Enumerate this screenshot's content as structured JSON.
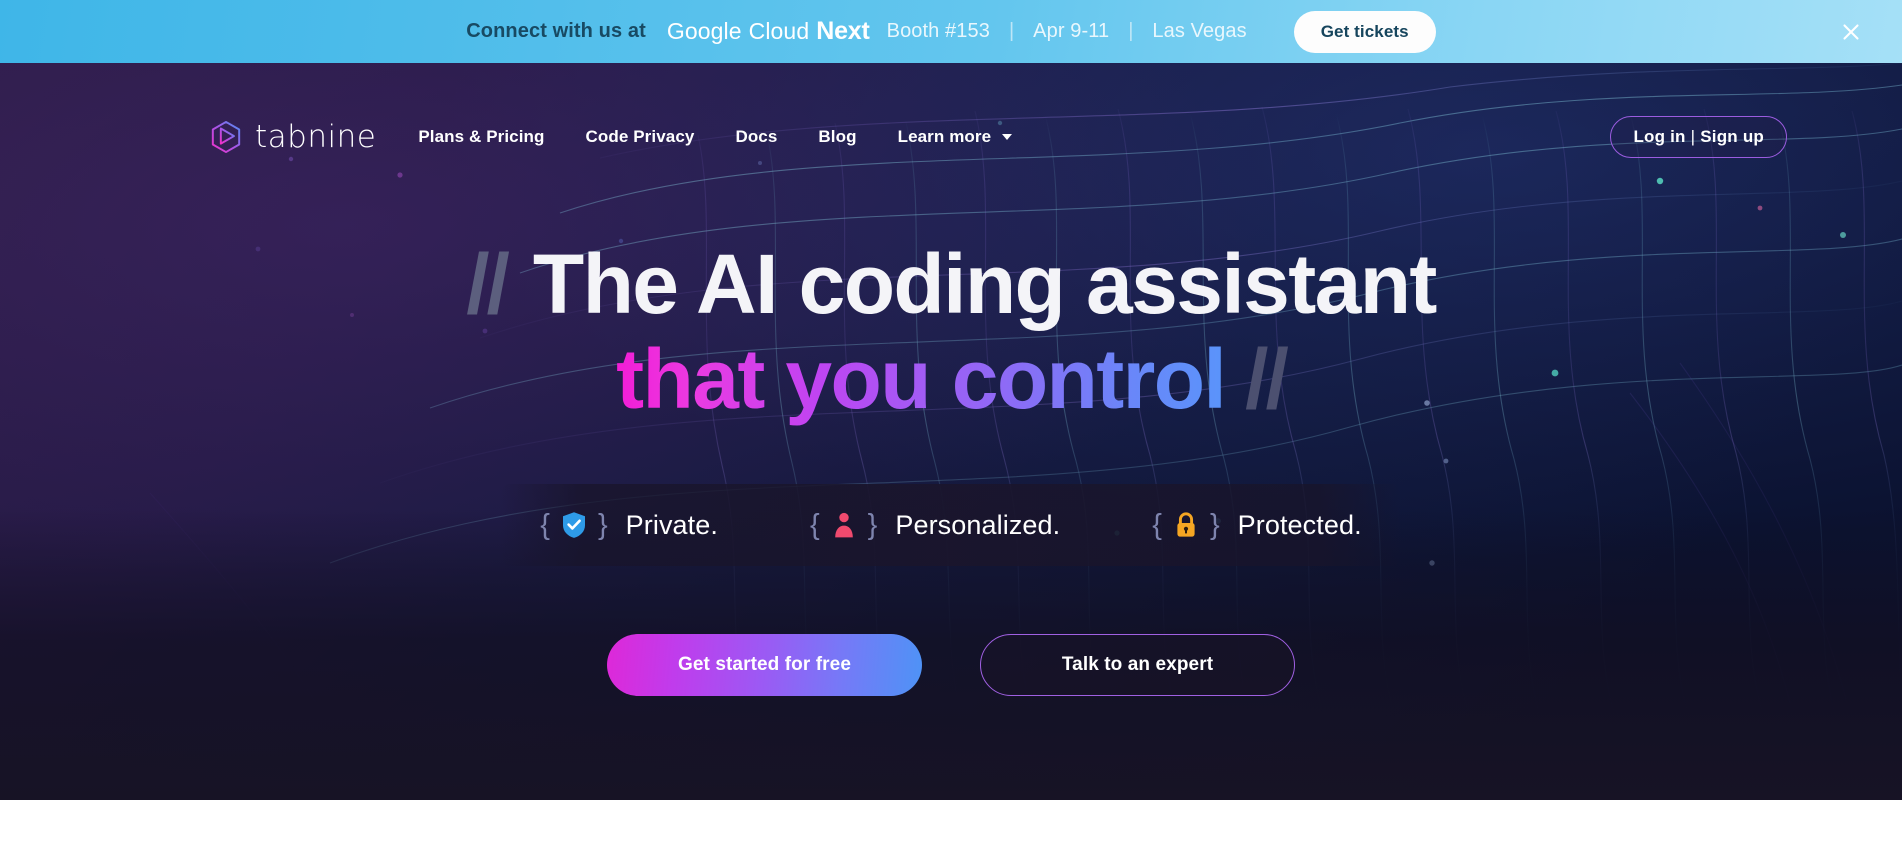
{
  "promo_banner": {
    "lead_text": "Connect with us at",
    "event": {
      "google": "Google",
      "cloud": "Cloud",
      "next": "Next"
    },
    "booth": "Booth #153",
    "dates": "Apr 9-11",
    "location": "Las Vegas",
    "separator": "|",
    "cta_label": "Get tickets",
    "close_icon": "close-icon",
    "background_color": "#63C6EE",
    "lead_text_color": "#184A63",
    "cta_bg_color": "#FDFDFD"
  },
  "nav": {
    "logo": {
      "text": "tabnine",
      "icon": "tabnine-hexagon-logo-icon"
    },
    "links": [
      {
        "label": "Plans & Pricing"
      },
      {
        "label": "Code Privacy"
      },
      {
        "label": "Docs"
      },
      {
        "label": "Blog"
      },
      {
        "label": "Learn more",
        "has_dropdown": true,
        "icon": "chevron-down-icon"
      }
    ],
    "auth": {
      "login": "Log in",
      "separator": "|",
      "signup": "Sign up",
      "border_color": "#9B5CE0"
    }
  },
  "hero": {
    "headline": {
      "slash_left": "//",
      "line1": "The AI coding assistant",
      "line2": "that you control",
      "slash_right": "//",
      "gradient_from": "#F21DD6",
      "gradient_to": "#5A94FA",
      "slash_color": "#5C5F7E"
    },
    "badges": [
      {
        "icon": "shield-check-icon",
        "label": "Private.",
        "icon_color": "#2E9BE8",
        "brace_open": "{",
        "brace_close": "}"
      },
      {
        "icon": "person-icon",
        "label": "Personalized.",
        "icon_color": "#F04A6E",
        "brace_open": "{",
        "brace_close": "}"
      },
      {
        "icon": "lock-icon",
        "label": "Protected.",
        "icon_color": "#F5A623",
        "brace_open": "{",
        "brace_close": "}"
      }
    ],
    "cta_primary": {
      "label": "Get started for free"
    },
    "cta_secondary": {
      "label": "Talk to an expert"
    }
  }
}
